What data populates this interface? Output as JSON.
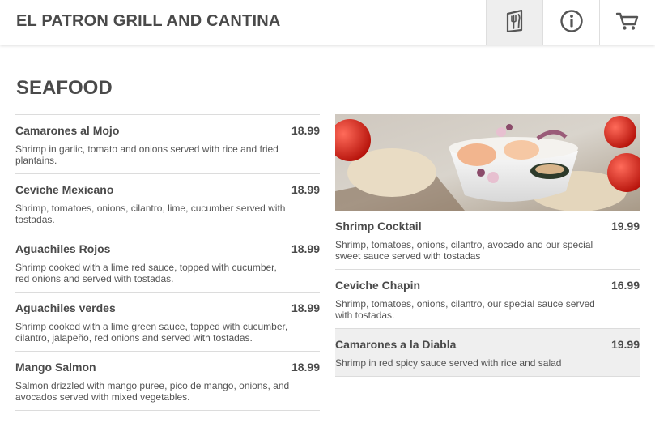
{
  "header": {
    "title": "EL PATRON GRILL AND CANTINA",
    "nav": [
      {
        "icon": "menu-fork-knife-icon"
      },
      {
        "icon": "info-icon"
      },
      {
        "icon": "cart-icon"
      }
    ]
  },
  "section": {
    "title": "SEAFOOD"
  },
  "left_items": [
    {
      "name": "Camarones al Mojo",
      "price": "18.99",
      "desc": "Shrimp in garlic, tomato and onions served with rice and fried plantains."
    },
    {
      "name": "Ceviche Mexicano",
      "price": "18.99",
      "desc": "Shrimp, tomatoes, onions, cilantro, lime, cucumber served with tostadas."
    },
    {
      "name": "Aguachiles Rojos",
      "price": "18.99",
      "desc": "Shrimp cooked with a lime red sauce, topped with cucumber, red onions and served with tostadas."
    },
    {
      "name": "Aguachiles verdes",
      "price": "18.99",
      "desc": "Shrimp cooked with a lime green sauce, topped with cucumber, cilantro, jalapeño, red onions and served with tostadas."
    },
    {
      "name": "Mango Salmon",
      "price": "18.99",
      "desc": "Salmon drizzled with mango puree, pico de mango, onions, and avocados served with mixed vegetables."
    }
  ],
  "right_items": [
    {
      "name": "Shrimp Cocktail",
      "price": "19.99",
      "desc": "Shrimp, tomatoes, onions, cilantro, avocado and our special sweet sauce served with tostadas"
    },
    {
      "name": "Ceviche Chapin",
      "price": "16.99",
      "desc": "Shrimp, tomatoes, onions, cilantro, our special sauce served with tostadas."
    },
    {
      "name": "Camarones a la Diabla",
      "price": "19.99",
      "desc": "Shrimp in red spicy sauce served with rice and salad"
    }
  ],
  "colors": {
    "text": "#4a4a4a",
    "active_nav_bg": "#eeeeee",
    "highlight_row_bg": "#efefef",
    "divider": "#dcdcdc"
  }
}
